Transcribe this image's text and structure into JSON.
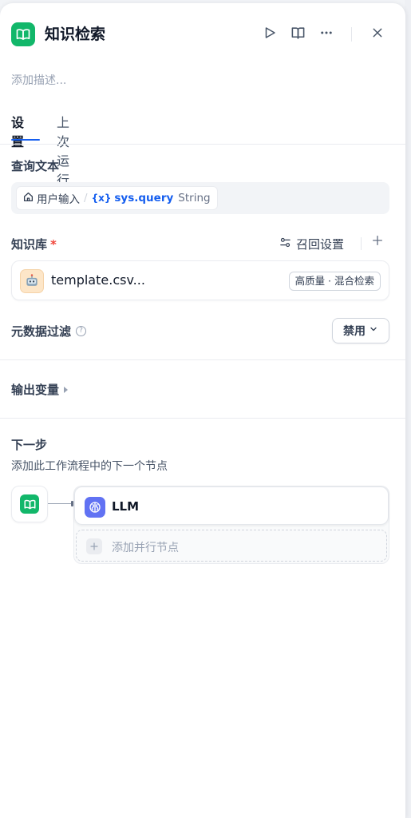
{
  "header": {
    "title": "知识检索",
    "description_placeholder": "添加描述..."
  },
  "tabs": [
    {
      "label": "设置",
      "active": true
    },
    {
      "label": "上次运行",
      "active": false
    }
  ],
  "query": {
    "label": "查询文本",
    "variable": {
      "source": "用户输入",
      "separator": "/",
      "name": "sys.query",
      "type": "String"
    }
  },
  "knowledge": {
    "label": "知识库",
    "required_mark": "*",
    "recall_settings_label": "召回设置",
    "add_icon": "plus-icon",
    "items": [
      {
        "name": "template.csv...",
        "badge": "高质量 · 混合检索",
        "icon": "robot-icon"
      }
    ]
  },
  "metadata_filter": {
    "label": "元数据过滤",
    "help_icon": "help-icon",
    "value": "禁用"
  },
  "output_vars": {
    "label": "输出变量"
  },
  "next_step": {
    "title": "下一步",
    "description": "添加此工作流程中的下一个节点",
    "nodes": [
      {
        "name": "LLM",
        "icon": "brain-icon"
      }
    ],
    "add_parallel_label": "添加并行节点"
  },
  "colors": {
    "node_green": "#12b76a",
    "accent_blue": "#155eef",
    "llm_purple": "#6172f3",
    "required_red": "#f04438"
  }
}
